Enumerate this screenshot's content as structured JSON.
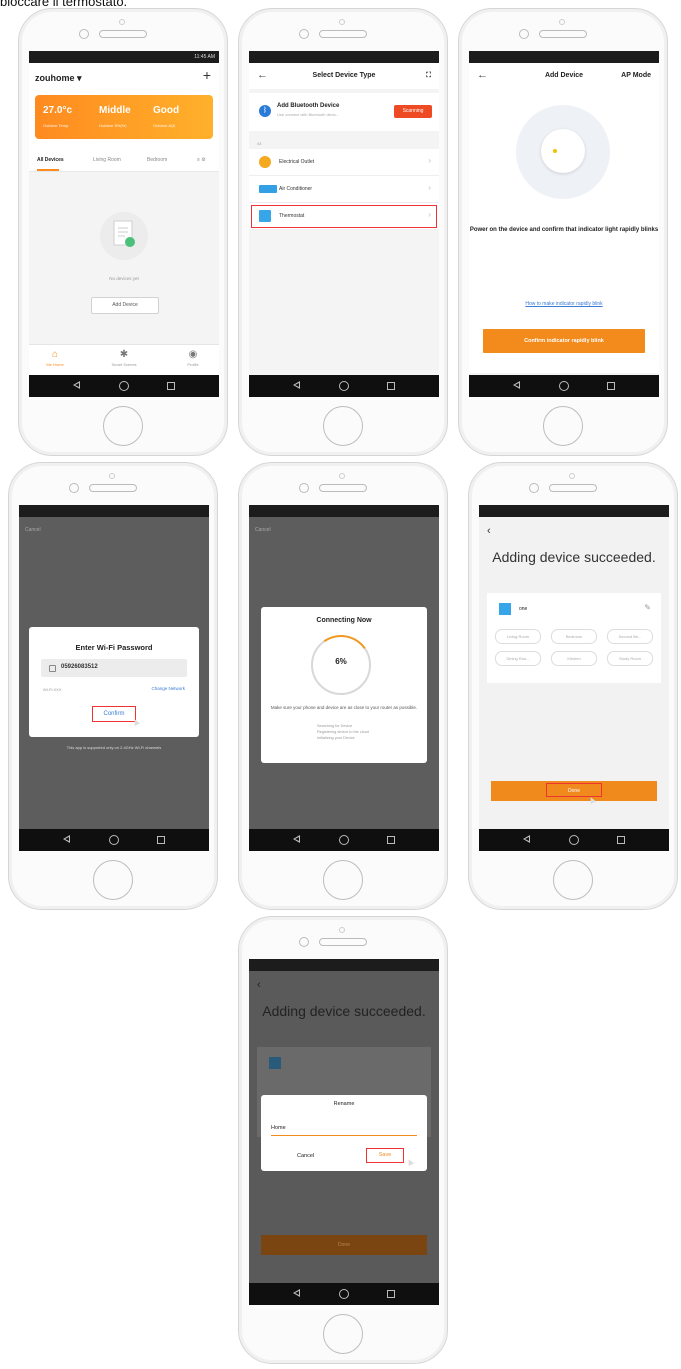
{
  "caption": "bloccare il termostato.",
  "p1": {
    "status": "11:45 AM",
    "home_name": "zouhome ▾",
    "plus": "+",
    "weather": {
      "temp": "27.0°c",
      "temp_sub": "Outdoor Temp.",
      "humidity": "Middle",
      "humidity_sub": "Outdoor RH(%)",
      "air": "Good",
      "air_sub": "Outdoor AQI"
    },
    "tabs": [
      "All Devices",
      "Living Room",
      "Bedroom"
    ],
    "empty": "No devices yet",
    "add_device": "Add Device",
    "bottom": [
      "Me Home",
      "Smart Scenes",
      "Profile"
    ]
  },
  "p2": {
    "title": "Select Device Type",
    "bt_title": "Add Bluetooth Device",
    "bt_sub": "Use connect with Bluetooth devic...",
    "scanning": "Scanning",
    "section": "All",
    "rows": [
      {
        "label": "Electrical Outlet",
        "color": "#f4a91f"
      },
      {
        "label": "Air Conditioner",
        "color": "#33a0e6"
      },
      {
        "label": "Thermostat",
        "color": "#37a6e8"
      }
    ]
  },
  "p3": {
    "title": "Add Device",
    "ap_mode": "AP Mode",
    "message": "Power on the device and confirm that indicator light rapidly blinks",
    "link": "How to make indicator rapidly blink",
    "button": "Confirm indicator rapidly blink"
  },
  "p4": {
    "cancel": "Cancel",
    "title": "Enter Wi-Fi Password",
    "password": "05926083512",
    "ssid": "Wi-Fi:XXX",
    "change": "Change Network",
    "confirm": "Confirm",
    "note": "This app is supported only on 2.4GHz Wi-Fi channels"
  },
  "p5": {
    "cancel": "Cancel",
    "title": "Connecting Now",
    "percent": "6%",
    "message": "Make sure your phone and device are as close to your router as possible.",
    "steps": [
      "Searching for Device",
      "Registering device to the cloud",
      "Initializing your Device"
    ]
  },
  "p6": {
    "back": "‹",
    "title": "Adding device succeeded.",
    "device_name": "one",
    "chips": [
      "Living Room",
      "Bedroom",
      "Second Be...",
      "Dining Roo...",
      "Kitchen",
      "Study Room"
    ],
    "done": "Done"
  },
  "p7": {
    "back": "‹",
    "title": "Adding device succeeded.",
    "rename": "Rename",
    "input": "Home",
    "cancel": "Cancel",
    "save": "Save",
    "done": "Done"
  }
}
